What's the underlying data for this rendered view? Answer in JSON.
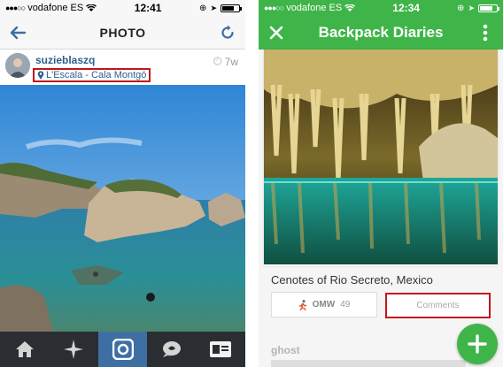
{
  "left_phone": {
    "status": {
      "carrier": "vodafone ES",
      "time": "12:41",
      "battery_level": 0.75
    },
    "nav": {
      "title": "PHOTO"
    },
    "post": {
      "username": "suzieblaszq",
      "location": "L'Escala - Cala Montgó",
      "age": "7w"
    },
    "tabs": [
      "home-icon",
      "explore-icon",
      "camera-icon",
      "activity-icon",
      "profile-icon"
    ],
    "colors": {
      "bar_bg": "#f7f7f7",
      "accent": "#3e6fa3",
      "tabbar": "#2a2d31",
      "highlight_box": "#c0151c"
    }
  },
  "right_phone": {
    "status": {
      "carrier": "vodafone ES",
      "time": "12:34",
      "battery_level": 0.8
    },
    "nav": {
      "title": "Backpack Diaries"
    },
    "post": {
      "caption": "Cenotes of Rio Secreto, Mexico",
      "omw_label": "OMW",
      "omw_count": "49",
      "comments_label": "Comments",
      "author": "ghost"
    },
    "colors": {
      "brand_green": "#3fb549",
      "highlight_box": "#c0151c"
    }
  }
}
